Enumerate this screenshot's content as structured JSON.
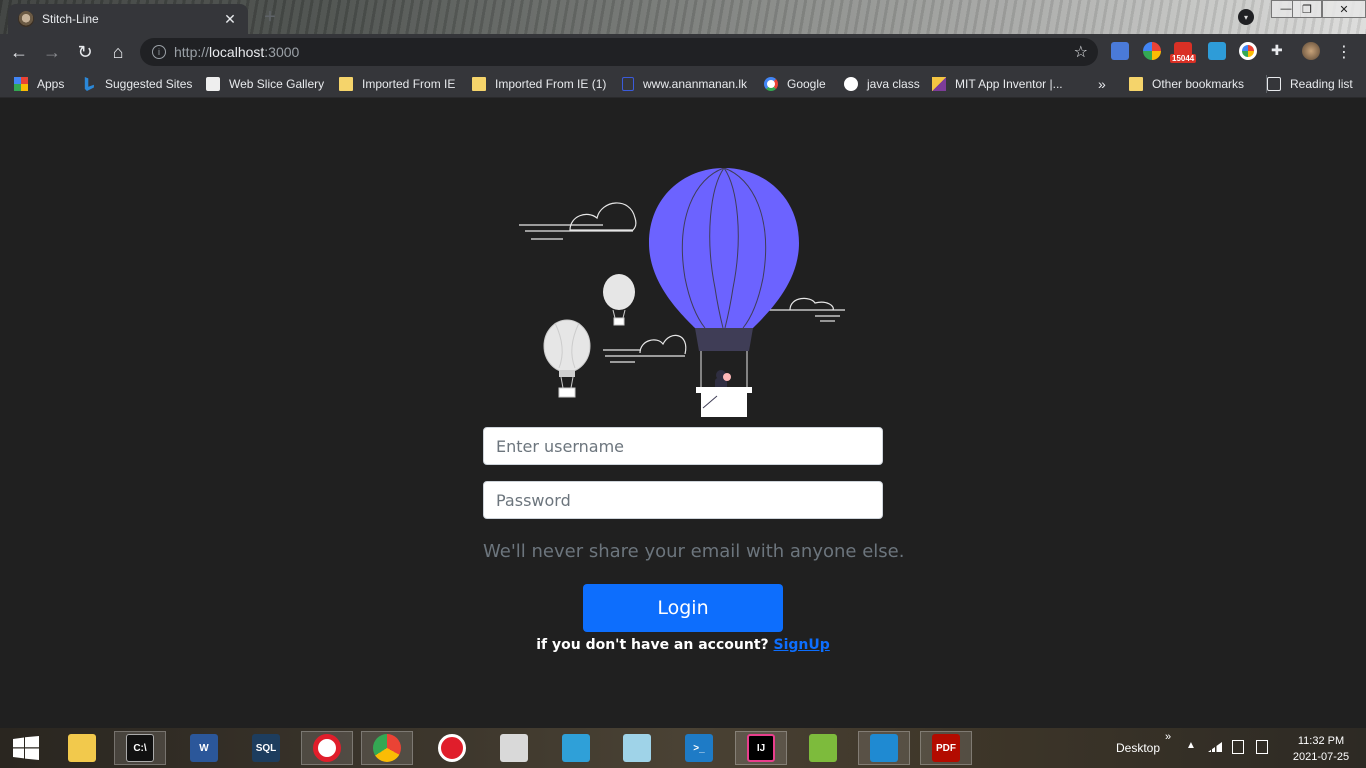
{
  "tab": {
    "title": "Stitch-Line",
    "close_glyph": "✕",
    "new_glyph": "+"
  },
  "window": {
    "minimize": "—",
    "restore": "❐",
    "close": "✕"
  },
  "toolbar": {
    "back_glyph": "←",
    "forward_glyph": "→",
    "reload_glyph": "↻",
    "home_glyph": "⌂",
    "url_scheme": "http://",
    "url_host": "localhost",
    "url_port": ":3000",
    "star_glyph": "☆",
    "ext_badge": "15044",
    "menu_glyph": "⋮"
  },
  "bookmarks": {
    "items": [
      {
        "label": "Apps",
        "icon": "apps-grid-icon"
      },
      {
        "label": "Suggested Sites",
        "icon": "bing-icon"
      },
      {
        "label": "Web Slice Gallery",
        "icon": "web-slice-icon"
      },
      {
        "label": "Imported From IE",
        "icon": "folder-icon"
      },
      {
        "label": "Imported From IE (1)",
        "icon": "folder-icon"
      },
      {
        "label": "www.ananmanan.lk",
        "icon": "page-icon"
      },
      {
        "label": "Google",
        "icon": "google-icon"
      },
      {
        "label": "java class",
        "icon": "globe-icon"
      },
      {
        "label": "MIT App Inventor |...",
        "icon": "app-inventor-icon"
      }
    ],
    "overflow": "»",
    "other": "Other bookmarks",
    "reading_list": "Reading list"
  },
  "login_form": {
    "username_placeholder": "Enter username",
    "password_placeholder": "Password",
    "help_text": "We'll never share your email with anyone else.",
    "login_label": "Login",
    "signup_prompt": "if you don't have an account?",
    "signup_link": "SignUp",
    "accent_color": "#0d6efd",
    "balloon_color": "#6c63ff"
  },
  "taskbar": {
    "desktop_label": "Desktop",
    "tray_overflow": "»",
    "time": "11:32 PM",
    "date": "2021-07-25"
  }
}
